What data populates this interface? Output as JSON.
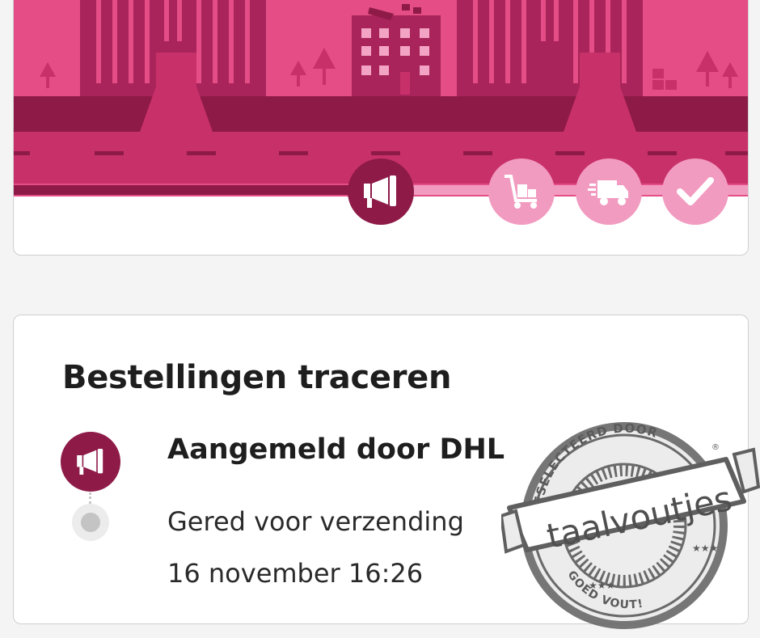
{
  "hero": {
    "stages": [
      {
        "name": "announced",
        "icon": "megaphone-icon",
        "state": "active"
      },
      {
        "name": "prepared",
        "icon": "trolley-icon",
        "state": "pending"
      },
      {
        "name": "in-transit",
        "icon": "delivery-truck-icon",
        "state": "pending"
      },
      {
        "name": "delivered",
        "icon": "checkmark-icon",
        "state": "pending"
      }
    ],
    "colors": {
      "sky": "#e44d86",
      "buildings": "#a8245a",
      "road": "#c8306a",
      "dark": "#8e1a48",
      "pending": "#f29bc0"
    }
  },
  "tracking": {
    "title": "Bestellingen traceren",
    "step": {
      "title": "Aangemeld door DHL",
      "status": "Gered voor verzending",
      "time": "16 november 16:26",
      "icon": "megaphone-icon"
    }
  },
  "stamp": {
    "top_text": "GESELECTEERD DOOR",
    "brand": "taalvoutjes",
    "bottom_text": "GOED VOUT!",
    "registered": "®"
  }
}
